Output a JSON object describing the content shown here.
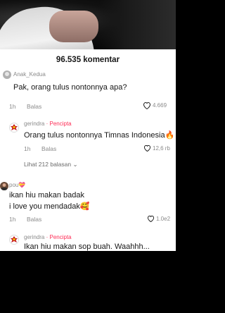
{
  "count_label": "96.535 komentar",
  "comments": [
    {
      "user": "Anak_Kedua",
      "text": "Pak, orang tulus nontonnya apa?",
      "time": "1h",
      "reply": "Balas",
      "likes": "4.669"
    }
  ],
  "replies": [
    {
      "user": "gerindra",
      "badge": "· Pencipta",
      "text": "Orang tulus nontonnya Timnas Indonesia🔥",
      "time": "1h",
      "reply": "Balas",
      "likes": "12,6 rb"
    }
  ],
  "view_replies": "Lihat 212 balasan",
  "comment2": {
    "user": "pou💝",
    "line1": "ikan hiu makan badak",
    "line2": "i love you mendadak🥰",
    "time": "1h",
    "reply": "Balas",
    "likes": "1.0e2"
  },
  "reply2": {
    "user": "gerindra",
    "badge": "· Pencipta",
    "text": "Ikan hiu makan sop buah. Waahhh..."
  },
  "colors": {
    "creator": "#fe2c55",
    "panel": "#ffffff",
    "text": "#161616",
    "muted": "#8a8a8a"
  },
  "icons": [
    "heart-icon",
    "chevron-down-icon",
    "avatar"
  ]
}
